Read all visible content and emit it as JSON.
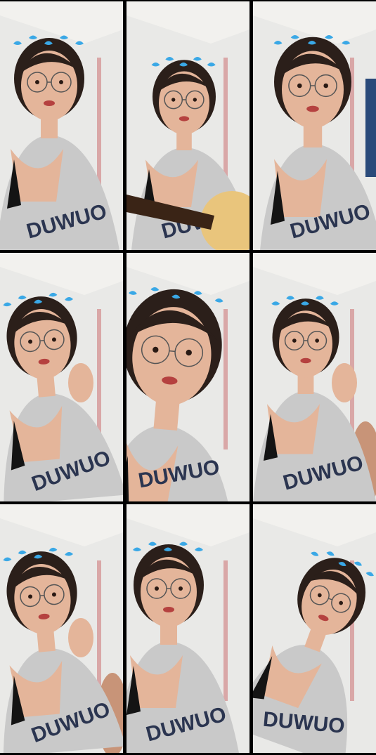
{
  "colors": {
    "background": "#000000",
    "wall": "#e9e9e7",
    "ceiling": "#f2f1ee",
    "skin": "#e4b59a",
    "hair": "#2b1f1a",
    "shirt": "#c9c9c9",
    "shirt_print": "#2b3550",
    "bra": "#141414",
    "bird": "#3aa8e6",
    "guitar_body": "#e9c57c",
    "guitar_neck": "#3a2416",
    "curtain": "#2a4a7a",
    "pink_trim": "#d9a7a7"
  },
  "shirt_print_text": "DUWUO",
  "tiles": [
    {
      "variant": "talking",
      "has_guitar": false,
      "has_child": false,
      "hand_up": false
    },
    {
      "variant": "guitar",
      "has_guitar": true,
      "has_child": false,
      "hand_up": false
    },
    {
      "variant": "smiling",
      "has_guitar": false,
      "has_child": false,
      "hand_up": false
    },
    {
      "variant": "eating",
      "has_guitar": false,
      "has_child": false,
      "hand_up": true
    },
    {
      "variant": "closeup",
      "has_guitar": false,
      "has_child": false,
      "hand_up": false
    },
    {
      "variant": "eating-child",
      "has_guitar": false,
      "has_child": true,
      "hand_up": true
    },
    {
      "variant": "hand-wave",
      "has_guitar": false,
      "has_child": true,
      "hand_up": true
    },
    {
      "variant": "smiling-2",
      "has_guitar": false,
      "has_child": false,
      "hand_up": false
    },
    {
      "variant": "turning-away",
      "has_guitar": false,
      "has_child": false,
      "hand_up": false
    }
  ]
}
